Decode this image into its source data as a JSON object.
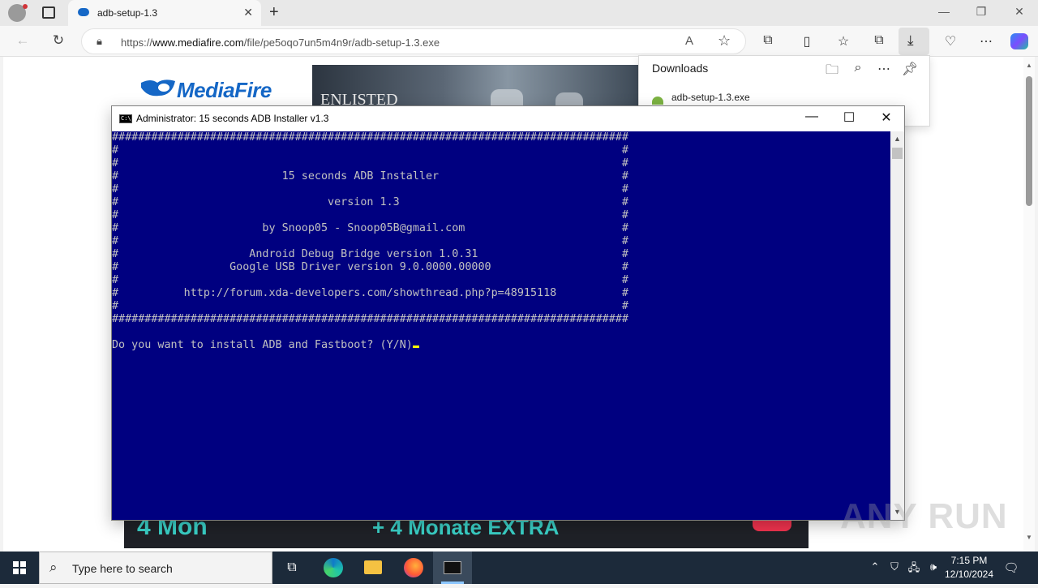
{
  "browser": {
    "tab_title": "adb-setup-1.3",
    "url_prefix": "https://",
    "url_host": "www.mediafire.com",
    "url_path": "/file/pe5oqo7un5m4n9r/adb-setup-1.3.exe"
  },
  "page": {
    "logo_text": "MediaFire",
    "ad_top_text": "ENLISTED",
    "ad_bottom_left": "4 Mon",
    "ad_bottom_mid": "+ 4 Monate EXTRA"
  },
  "downloads": {
    "title": "Downloads",
    "file_name": "adb-setup-1.3.exe"
  },
  "console": {
    "title": "Administrator:  15 seconds ADB Installer v1.3",
    "lines": [
      "###############################################################################",
      "#                                                                             #",
      "#                                                                             #",
      "#                         15 seconds ADB Installer                            #",
      "#                                                                             #",
      "#                                version 1.3                                  #",
      "#                                                                             #",
      "#                      by Snoop05 - Snoop05B@gmail.com                        #",
      "#                                                                             #",
      "#                    Android Debug Bridge version 1.0.31                      #",
      "#                 Google USB Driver version 9.0.0000.00000                    #",
      "#                                                                             #",
      "#          http://forum.xda-developers.com/showthread.php?p=48915118          #",
      "#                                                                             #",
      "###############################################################################",
      "",
      "Do you want to install ADB and Fastboot? (Y/N)"
    ]
  },
  "watermark": "ANY RUN",
  "taskbar": {
    "search_placeholder": "Type here to search",
    "time": "7:15 PM",
    "date": "12/10/2024"
  }
}
